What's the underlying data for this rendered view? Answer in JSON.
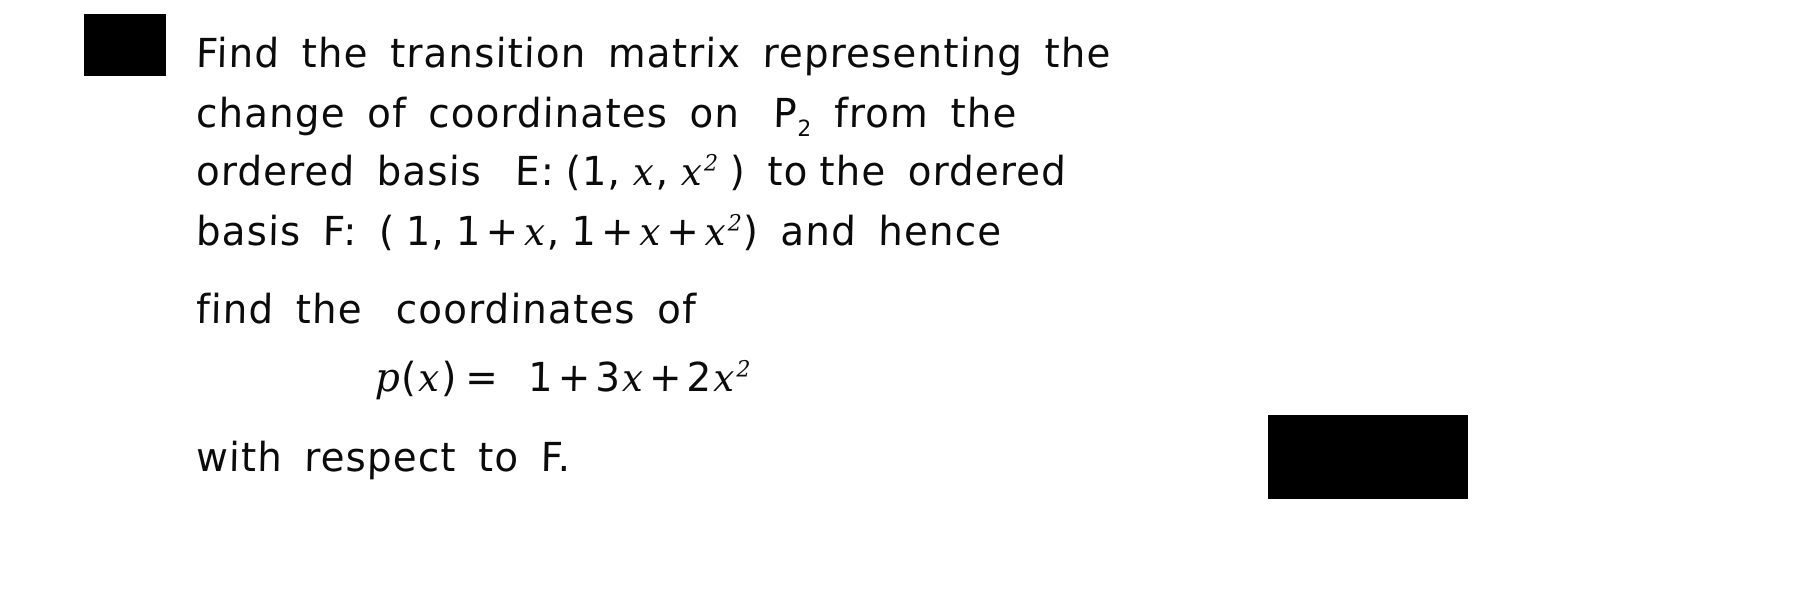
{
  "document": {
    "kind": "handwritten-note",
    "subject": "linear algebra problem statement",
    "ink_color": "#0b0b0b",
    "paper_color": "#ffffff",
    "redaction_color": "#000000",
    "full_text": "Find the transition matrix representing the change of coordinates on P2 from the ordered basis E: (1, x, x^2) to the ordered basis F: (1, 1+x, 1+x+x^2) and hence find the coordinates of p(x) = 1 + 3x + 2x^2 with respect to F."
  },
  "lines": {
    "l1": {
      "w1": "Find",
      "w2": "the",
      "w3": "transition",
      "w4": "matrix",
      "w5": "representing",
      "w6": "the"
    },
    "l2": {
      "w1": "change",
      "w2": "of",
      "w3": "coordinates",
      "w4": "on",
      "space_symbol": "P",
      "space_degree": "2",
      "w5": "from",
      "w6": "the"
    },
    "l3": {
      "w1": "ordered",
      "w2": "basis",
      "basis_name": "E",
      "colon": ":",
      "open": "(",
      "e1": "1",
      "c1": ",",
      "e2": "x",
      "c2": ",",
      "e3_base": "x",
      "e3_exp": "2",
      "close": ")",
      "w3": "to",
      "w4": "the",
      "w5": "ordered"
    },
    "l4": {
      "w1": "basis",
      "basis_name": "F",
      "colon": ":",
      "open": "(",
      "f1": "1",
      "c1": ",",
      "f2_const": "1",
      "f2_plus": "+",
      "f2_var": "x",
      "c2": ",",
      "f3_const": "1",
      "f3_plus1": "+",
      "f3_var": "x",
      "f3_plus2": "+",
      "f3_sq_base": "x",
      "f3_sq_exp": "2",
      "close": ")",
      "w2": "and",
      "w3": "hence"
    },
    "l5": {
      "w1": "find",
      "w2": "the",
      "w3": "coordinates",
      "w4": "of"
    },
    "l6": {
      "fn_name": "p",
      "open": "(",
      "fn_arg": "x",
      "close": ")",
      "equals": "=",
      "t1": "1",
      "op1": "+",
      "t2_coeff": "3",
      "t2_var": "x",
      "op2": "+",
      "t3_coeff": "2",
      "t3_var": "x",
      "t3_exp": "2"
    },
    "l7": {
      "w1": "with",
      "w2": "respect",
      "w3": "to",
      "w4": "F."
    }
  },
  "chart_data": null
}
